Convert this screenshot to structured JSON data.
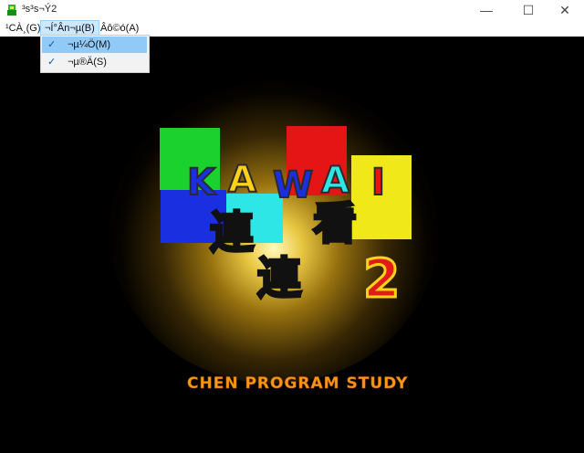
{
  "window": {
    "title": "³s³s¬Ý2",
    "buttons": {
      "minimize": "—",
      "maximize": "☐",
      "close": "✕"
    }
  },
  "menu": {
    "items": [
      {
        "label": "¹CÀ¸(G)"
      },
      {
        "label": "¬Í°Ân¬µ(B)",
        "active": true
      },
      {
        "label": "Âô©ó(A)"
      }
    ],
    "dropdown": [
      {
        "label": "¬µ¼Ö(M)",
        "checked": true,
        "highlighted": true
      },
      {
        "label": "¬µ®Ä(S)",
        "checked": true,
        "highlighted": false
      }
    ],
    "check_glyph": "✓"
  },
  "game": {
    "logo_letters": [
      {
        "char": "K",
        "color": "#1a2fe0"
      },
      {
        "char": "A",
        "color": "#ffd21a"
      },
      {
        "char": "W",
        "color": "#1a2fe0"
      },
      {
        "char": "A",
        "color": "#2fe6e6"
      },
      {
        "char": "I",
        "color": "#e61515"
      }
    ],
    "kanji": [
      {
        "char": "連",
        "color": "#1a2fe0"
      },
      {
        "char": "連",
        "color": "#1a2fe0"
      },
      {
        "char": "看",
        "color": "#e61515"
      }
    ],
    "number": "2",
    "credits": "CHEN PROGRAM STUDY"
  }
}
